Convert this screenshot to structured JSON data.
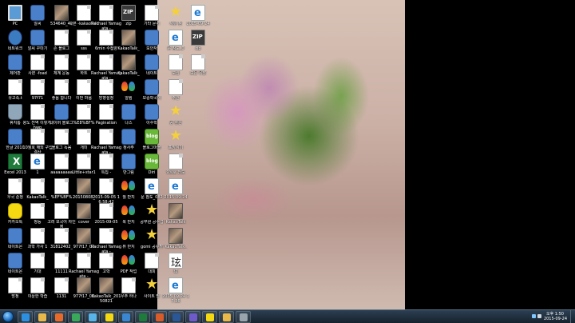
{
  "desktop": {
    "icons": [
      {
        "label": "PC",
        "kind": "computer"
      },
      {
        "label": "네트워크",
        "kind": "network"
      },
      {
        "label": "제어판",
        "kind": "app"
      },
      {
        "label": "유고족.t",
        "kind": "doc"
      },
      {
        "label": "휴지통",
        "kind": "recycle"
      },
      {
        "label": "한글 2010",
        "kind": "app"
      },
      {
        "label": "Excel 2013",
        "kind": "excel"
      },
      {
        "label": "우국 순정",
        "kind": "doc"
      },
      {
        "label": "카카오톡",
        "kind": "talk"
      },
      {
        "label": "네이트온",
        "kind": "app"
      },
      {
        "label": "네이트온",
        "kind": "app"
      },
      {
        "label": "방정",
        "kind": "doc"
      },
      {
        "label": "알씨",
        "kind": "app"
      },
      {
        "label": "알씨 꾸미기",
        "kind": "app"
      },
      {
        "label": "사본 -foad",
        "kind": "doc"
      },
      {
        "label": "97f71",
        "kind": "doc"
      },
      {
        "label": "왕노 전역 이렇게.hwp",
        "kind": "doc"
      },
      {
        "label": "10월호 해외 구입 결산",
        "kind": "doc"
      },
      {
        "label": "1",
        "kind": "ie"
      },
      {
        "label": "KakaoTalk_",
        "kind": "doc"
      },
      {
        "label": "정능",
        "kind": "doc"
      },
      {
        "label": "과학 가사 1",
        "kind": "doc"
      },
      {
        "label": "기대",
        "kind": "doc"
      },
      {
        "label": "이상한 학습",
        "kind": "doc"
      },
      {
        "label": "534640_42",
        "kind": "img"
      },
      {
        "label": "손 블로그",
        "kind": "doc"
      },
      {
        "label": "체계 운동",
        "kind": "doc"
      },
      {
        "label": "좋음 합니다",
        "kind": "doc"
      },
      {
        "label": "네이버 블로그",
        "kind": "app"
      },
      {
        "label": "블로그 녹음",
        "kind": "doc"
      },
      {
        "label": "aaaaaaaaa",
        "kind": "doc"
      },
      {
        "label": "%EF%BF%",
        "kind": "doc"
      },
      {
        "label": "고려 모국어 자인정",
        "kind": "doc"
      },
      {
        "label": "31812402_",
        "kind": "doc"
      },
      {
        "label": "11111",
        "kind": "doc"
      },
      {
        "label": "1131",
        "kind": "doc"
      },
      {
        "label": "사본 -kakaoTalk_",
        "kind": "doc"
      },
      {
        "label": "sss",
        "kind": "doc"
      },
      {
        "label": "하트",
        "kind": "doc"
      },
      {
        "label": "이번 마음",
        "kind": "doc"
      },
      {
        "label": "%E8%BF%",
        "kind": "doc"
      },
      {
        "label": "개미",
        "kind": "doc"
      },
      {
        "label": "Little+star1",
        "kind": "doc"
      },
      {
        "label": "20150808_",
        "kind": "img"
      },
      {
        "label": "cover",
        "kind": "img"
      },
      {
        "label": "977f17_03",
        "kind": "img"
      },
      {
        "label": "Rachael Yamagata -",
        "kind": "doc"
      },
      {
        "label": "977f17_03",
        "kind": "img"
      },
      {
        "label": "Rachael Yamagata -",
        "kind": "doc"
      },
      {
        "label": "6min 수첩양",
        "kind": "doc"
      },
      {
        "label": "Rachael Yamagata -",
        "kind": "doc"
      },
      {
        "label": "방향설정",
        "kind": "doc"
      },
      {
        "label": "Pagination",
        "kind": "doc"
      },
      {
        "label": "Rachael Yamagata -",
        "kind": "doc"
      },
      {
        "label": "특집 -",
        "kind": "doc"
      },
      {
        "label": "2015-09-05 16:58:42",
        "kind": "doc"
      },
      {
        "label": "2015-09-05",
        "kind": "doc"
      },
      {
        "label": "Rachael Yamagata -",
        "kind": "doc"
      },
      {
        "label": "고학",
        "kind": "doc"
      },
      {
        "label": "KakaoTalk_20150821",
        "kind": "img"
      },
      {
        "label": "zip",
        "kind": "zip"
      },
      {
        "label": "KakaoTalk_",
        "kind": "img"
      },
      {
        "label": "KakaoTalk_",
        "kind": "img"
      },
      {
        "label": "알림",
        "kind": "butterfly"
      },
      {
        "label": "나스",
        "kind": "app"
      },
      {
        "label": "정사주",
        "kind": "app"
      },
      {
        "label": "반그림",
        "kind": "app"
      },
      {
        "label": "월 반지",
        "kind": "butterfly"
      },
      {
        "label": "복 반지",
        "kind": "butterfly"
      },
      {
        "label": "뷰 반지",
        "kind": "butterfly"
      },
      {
        "label": "PDF 작업",
        "kind": "butterfly"
      },
      {
        "label": "우주 하나",
        "kind": "doc"
      },
      {
        "label": "기타 문서",
        "kind": "doc"
      },
      {
        "label": "보안자",
        "kind": "app"
      },
      {
        "label": "네이트",
        "kind": "app"
      },
      {
        "label": "모중학국어",
        "kind": "app"
      },
      {
        "label": "이수학",
        "kind": "app"
      },
      {
        "label": "블로그마을",
        "kind": "blog"
      },
      {
        "label": "Diri",
        "kind": "blog"
      },
      {
        "label": "문 참도_082",
        "kind": "ie"
      },
      {
        "label": "공무원 공수업",
        "kind": "star"
      },
      {
        "label": "gomi 공유할",
        "kind": "star"
      },
      {
        "label": "대피",
        "kind": "doc"
      },
      {
        "label": "사이트 별",
        "kind": "star"
      },
      {
        "label": "서류 참",
        "kind": "star"
      },
      {
        "label": "문 참도_0",
        "kind": "ie"
      },
      {
        "label": "모임",
        "kind": "doc"
      },
      {
        "label": "주관",
        "kind": "doc"
      },
      {
        "label": "공 좋은",
        "kind": "star"
      },
      {
        "label": "포장식이",
        "kind": "star"
      },
      {
        "label": "9월호 전도",
        "kind": "doc"
      },
      {
        "label": "2015-09-24",
        "kind": "ie"
      },
      {
        "label": "KakaoTalk",
        "kind": "img"
      },
      {
        "label": "KakaoTalk_",
        "kind": "img"
      },
      {
        "label": "玹",
        "kind": "hanja"
      },
      {
        "label": "2015-09-24 17:36",
        "kind": "ie"
      },
      {
        "label": "2015-09-24",
        "kind": "ie"
      },
      {
        "label": "zip",
        "kind": "zip"
      },
      {
        "label": "모든 목장",
        "kind": "doc"
      }
    ]
  },
  "taskbar": {
    "start_label": "시작",
    "clock_time": "오후 1:50",
    "clock_date": "2015-09-24",
    "pinned": [
      {
        "name": "ie",
        "color": "#2d8fe0"
      },
      {
        "name": "explorer",
        "color": "#e9b84a"
      },
      {
        "name": "media-player",
        "color": "#e86a2a"
      },
      {
        "name": "chrome",
        "color": "#3aa85a"
      },
      {
        "name": "safari",
        "color": "#58b3e8"
      },
      {
        "name": "talk",
        "color": "#f4d812"
      },
      {
        "name": "hwp",
        "color": "#3a86d1"
      },
      {
        "name": "excel",
        "color": "#1e7b3c"
      },
      {
        "name": "ppt",
        "color": "#d85b2a"
      },
      {
        "name": "word",
        "color": "#2b5797"
      },
      {
        "name": "app-7",
        "color": "#6e5ac9"
      },
      {
        "name": "kakao",
        "color": "#f4d812"
      },
      {
        "name": "folder",
        "color": "#e9b84a"
      },
      {
        "name": "app-8",
        "color": "#9aa4ad"
      }
    ]
  }
}
